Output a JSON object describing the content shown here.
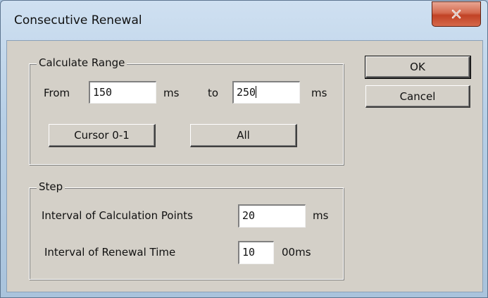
{
  "window": {
    "title": "Consecutive Renewal",
    "close_icon": "close-icon"
  },
  "calculate_range": {
    "group_label": "Calculate Range",
    "from_label": "From",
    "from_value": "150",
    "from_unit": "ms",
    "to_label": "to",
    "to_value": "250",
    "to_unit": "ms",
    "cursor_button": "Cursor 0-1",
    "all_button": "All"
  },
  "step": {
    "group_label": "Step",
    "calc_points_label": "Interval of Calculation Points",
    "calc_points_value": "20",
    "calc_points_unit": "ms",
    "renewal_label": "Interval of Renewal Time",
    "renewal_value": "10",
    "renewal_unit": "00ms"
  },
  "actions": {
    "ok": "OK",
    "cancel": "Cancel"
  },
  "colors": {
    "dialog_face": "#d4d0c8",
    "close_button": "#c8452a",
    "title_bar": "#b7cfe6"
  }
}
